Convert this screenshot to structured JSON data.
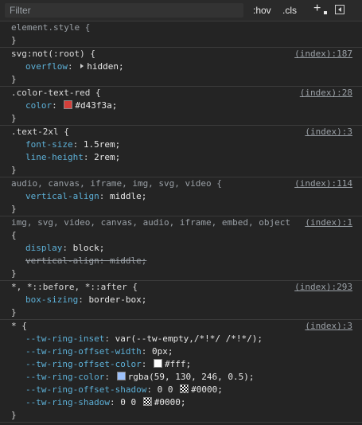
{
  "toolbar": {
    "filter_placeholder": "Filter",
    "hov_label": ":hov",
    "cls_label": ".cls",
    "add_label": "+"
  },
  "rules": [
    {
      "selector": "element.style {",
      "source": "",
      "decls": []
    },
    {
      "selector": "svg:not(:root) {",
      "source": "(index):187",
      "decls": [
        {
          "prop": "overflow",
          "value": "hidden;"
        }
      ]
    },
    {
      "selector": ".color-text-red {",
      "source": "(index):28",
      "decls": [
        {
          "prop": "color",
          "value": "#d43f3a;",
          "swatch": "#d43f3a"
        }
      ]
    },
    {
      "selector": ".text-2xl {",
      "source": "(index):3",
      "decls": [
        {
          "prop": "font-size",
          "value": "1.5rem;"
        },
        {
          "prop": "line-height",
          "value": "2rem;"
        }
      ]
    },
    {
      "selector": "audio, canvas, iframe, img, svg, video {",
      "source": "(index):114",
      "decls": [
        {
          "prop": "vertical-align",
          "value": "middle;"
        }
      ]
    },
    {
      "selector": "img, svg, video, canvas, audio, iframe, embed, object",
      "source": "(index):1",
      "decls": [
        {
          "prop": "display",
          "value": "block;"
        },
        {
          "prop": "vertical-align",
          "value": "middle;",
          "struck": true
        }
      ]
    },
    {
      "selector": "*, *::before, *::after {",
      "source": "(index):293",
      "decls": [
        {
          "prop": "box-sizing",
          "value": "border-box;"
        }
      ]
    },
    {
      "selector": "* {",
      "source": "(index):3",
      "decls": [
        {
          "prop": "--tw-ring-inset",
          "value": "var(--tw-empty,/*!*/ /*!*/);"
        },
        {
          "prop": "--tw-ring-offset-width",
          "value": "0px;"
        },
        {
          "prop": "--tw-ring-offset-color",
          "value": "#fff;",
          "swatch": "#ffffff"
        },
        {
          "prop": "--tw-ring-color",
          "value": "rgba(59, 130, 246, 0.5);",
          "swatch": "#9cc0fa"
        },
        {
          "prop": "--tw-ring-offset-shadow",
          "value": "0 0 ",
          "swatch_after": "#0000",
          "value_after": "#0000;"
        },
        {
          "prop": "--tw-ring-shadow",
          "value": "0 0 ",
          "swatch_after": "#0000",
          "value_after": "#0000;"
        }
      ]
    }
  ],
  "closing_brace": "}",
  "open_brace": "{",
  "colon": ": "
}
